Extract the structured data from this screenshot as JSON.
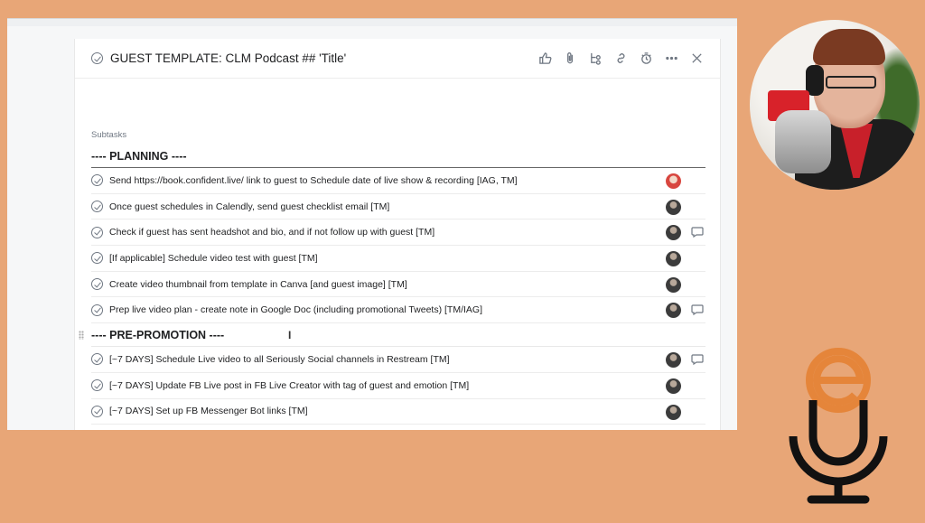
{
  "task": {
    "title": "GUEST TEMPLATE: CLM Podcast ## 'Title'"
  },
  "toolbar": {
    "icons": [
      "thumbs-up-icon",
      "attachment-icon",
      "subtask-icon",
      "link-icon",
      "timer-icon",
      "more-icon",
      "close-icon"
    ]
  },
  "subtasks_label": "Subtasks",
  "sections": [
    {
      "title": "---- PLANNING ----",
      "items": [
        {
          "text": "Send https://book.confident.live/ link to guest to Schedule date of live show & recording [IAG, TM]",
          "assignee": "red",
          "comment": false
        },
        {
          "text": "Once guest schedules in Calendly, send guest checklist email  [TM]",
          "assignee": "dark",
          "comment": false
        },
        {
          "text": "Check if guest has sent headshot and bio, and if not follow up with guest  [TM]",
          "assignee": "dark",
          "comment": true
        },
        {
          "text": "[If applicable] Schedule video test with guest [TM]",
          "assignee": "dark",
          "comment": false
        },
        {
          "text": "Create video thumbnail from template in Canva [and guest image] [TM]",
          "assignee": "dark",
          "comment": false
        },
        {
          "text": "Prep live video plan - create note in Google Doc (including promotional Tweets)  [TM/IAG]",
          "assignee": "dark",
          "comment": true
        }
      ]
    },
    {
      "title": "---- PRE-PROMOTION ----",
      "items": [
        {
          "text": "[~7 DAYS] Schedule Live video to all Seriously Social channels in Restream [TM]",
          "assignee": "dark",
          "comment": true
        },
        {
          "text": "[~7 DAYS] Update FB Live post in FB Live Creator with tag of guest and emotion [TM]",
          "assignee": "dark",
          "comment": false
        },
        {
          "text": "[~7 DAYS] Set up FB Messenger Bot links [TM]",
          "assignee": "dark",
          "comment": false
        }
      ]
    }
  ],
  "colors": {
    "background": "#e8a677",
    "logo": "#e5853a",
    "logo_dark": "#111111"
  }
}
